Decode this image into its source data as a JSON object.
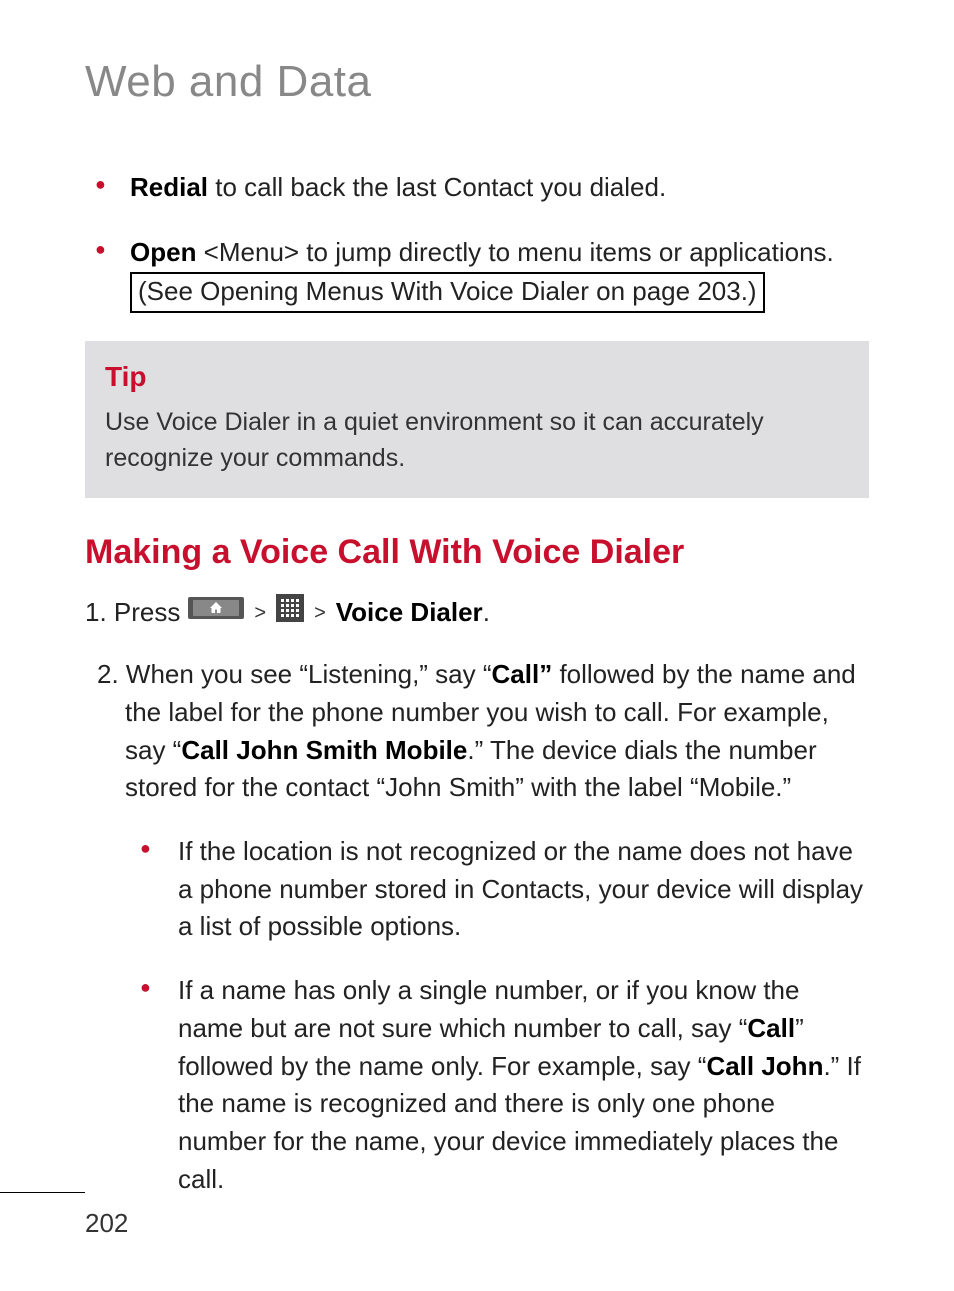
{
  "page_title": "Web and Data",
  "bullets": {
    "redial_bold": "Redial",
    "redial_text": " to call back the last Contact you dialed.",
    "open_bold": " Open",
    "open_text": " <Menu> to jump directly to menu items or applications. ",
    "open_boxed": "(See Opening Menus With Voice Dialer on page 203.)"
  },
  "tip": {
    "title": "Tip",
    "body": "Use Voice Dialer in a quiet environment so it can accurately recognize your commands."
  },
  "section_heading": "Making a Voice Call With Voice Dialer",
  "step1": {
    "prefix": "1. Press ",
    "voice_dialer": "Voice Dialer",
    "period": "."
  },
  "step2": {
    "prefix": "2. When you see “Listening,” say “",
    "call_bold": "Call”",
    "mid1": " followed by the name and the label for the phone number you wish to call. For example, say “",
    "example_bold": "Call John Smith Mobile",
    "suffix": ".” The device dials the number stored for the contact “John Smith” with the label “Mobile.”"
  },
  "sub_bullets": {
    "item1": " If the location is not recognized or the name does not have a phone number stored in Contacts, your device will display a list of possible options.",
    "item2_a": " If a name has only a single number, or if you know the name but are not sure which number to call, say “",
    "item2_call": "Call",
    "item2_b": "” followed by the name only. For example, say “",
    "item2_calljohn": "Call John",
    "item2_c": ".” If the name is recognized and there is only one phone number for the name, your device immediately places the call."
  },
  "page_number": "202"
}
